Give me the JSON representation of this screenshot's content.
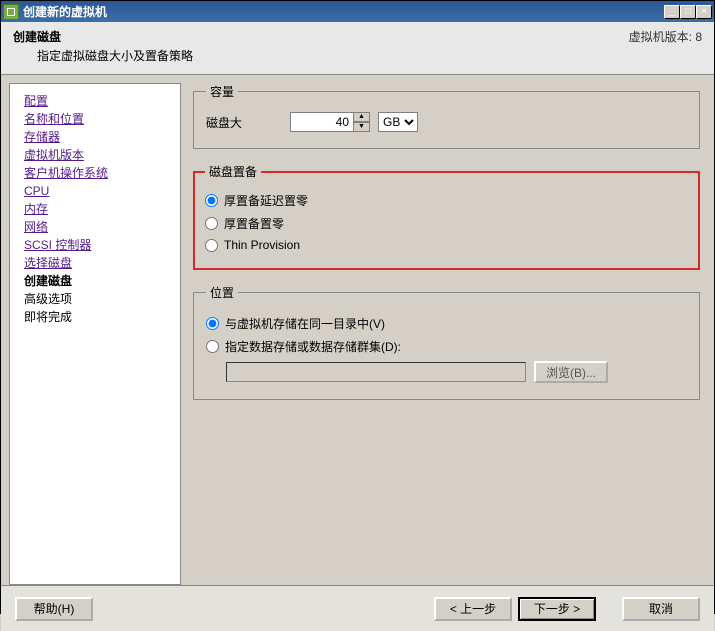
{
  "window": {
    "title": "创建新的虚拟机",
    "min": "_",
    "max": "□",
    "close": "×"
  },
  "header": {
    "title": "创建磁盘",
    "subtitle": "指定虚拟磁盘大小及置备策略",
    "version": "虚拟机版本: 8"
  },
  "sidebar": {
    "items": [
      "配置",
      "名称和位置",
      "存储器",
      "虚拟机版本",
      "客户机操作系统",
      "CPU",
      "内存",
      "网络",
      "SCSI 控制器",
      "选择磁盘",
      "创建磁盘",
      "高级选项",
      "即将完成"
    ]
  },
  "capacity": {
    "legend": "容量",
    "label": "磁盘大",
    "value": "40",
    "unit": "GB"
  },
  "provision": {
    "legend": "磁盘置备",
    "opt1": "厚置备延迟置零",
    "opt2": "厚置备置零",
    "opt3": "Thin Provision"
  },
  "location": {
    "legend": "位置",
    "opt1": "与虚拟机存储在同一目录中(V)",
    "opt2": "指定数据存储或数据存储群集(D):",
    "browse": "浏览(B)..."
  },
  "footer": {
    "help": "帮助(H)",
    "back": "< 上一步",
    "next": "下一步 >",
    "cancel": "取消"
  }
}
